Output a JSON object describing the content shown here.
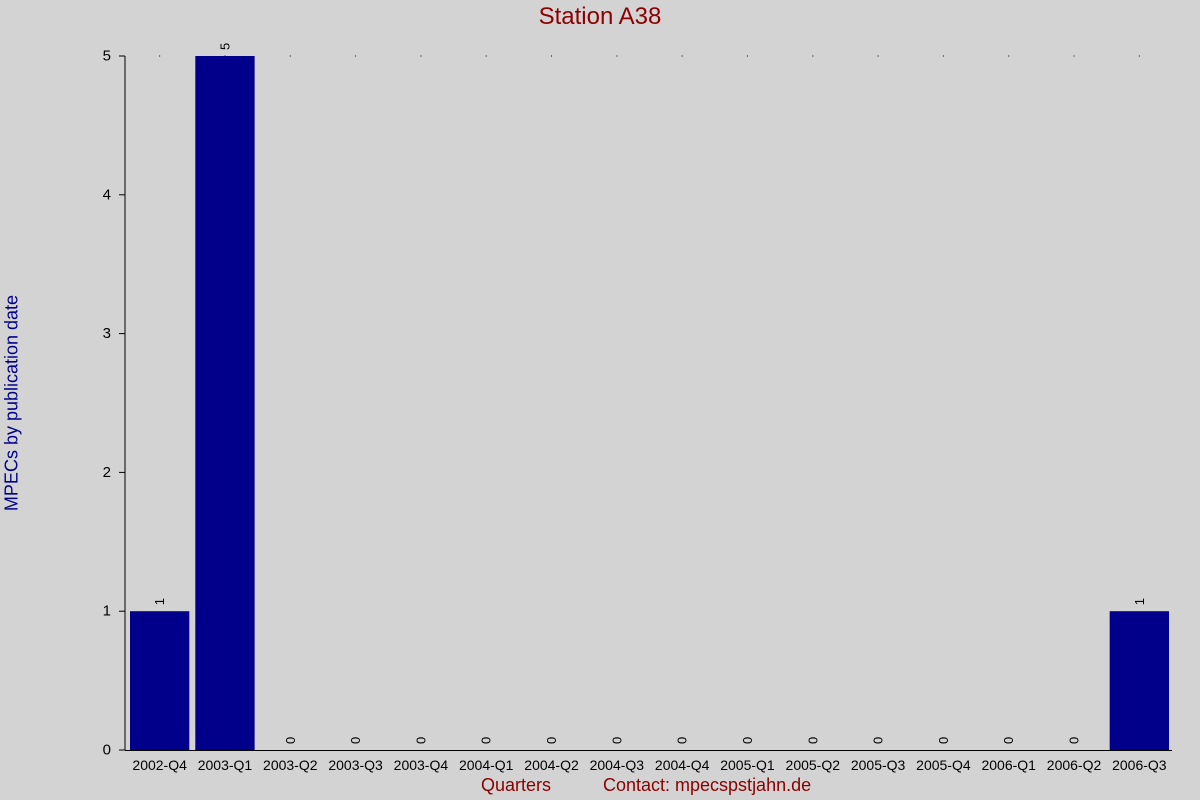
{
  "chart_data": {
    "type": "bar",
    "title": "Station A38",
    "xlabel": "Quarters",
    "ylabel": "MPECs by publication date",
    "contact": "Contact: mpecspstjahn.de",
    "categories": [
      "2002-Q4",
      "2003-Q1",
      "2003-Q2",
      "2003-Q3",
      "2003-Q4",
      "2004-Q1",
      "2004-Q2",
      "2004-Q3",
      "2004-Q4",
      "2005-Q1",
      "2005-Q2",
      "2005-Q3",
      "2005-Q4",
      "2006-Q1",
      "2006-Q2",
      "2006-Q3"
    ],
    "values": [
      1,
      5,
      0,
      0,
      0,
      0,
      0,
      0,
      0,
      0,
      0,
      0,
      0,
      0,
      0,
      1
    ],
    "ylim": [
      0,
      5
    ],
    "yticks": [
      0,
      1,
      2,
      3,
      4,
      5
    ],
    "grid": false,
    "colors": {
      "bar": "#00008b",
      "background": "#d3d3d3",
      "title": "#8b0000",
      "ylabel": "#00008b",
      "axis": "#000000"
    }
  }
}
